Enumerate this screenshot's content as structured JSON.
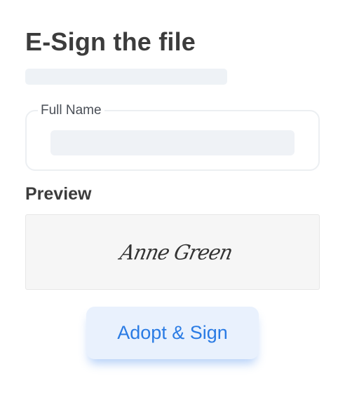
{
  "header": {
    "title": "E-Sign the file"
  },
  "full_name_field": {
    "label": "Full Name",
    "value": "",
    "placeholder": ""
  },
  "preview": {
    "heading": "Preview",
    "signature_text": "Anne Green"
  },
  "actions": {
    "adopt_sign_label": "Adopt & Sign"
  },
  "colors": {
    "accent": "#2a7be4",
    "button_bg": "#e9f1fd",
    "input_bg": "#eff2f6",
    "preview_bg": "#f6f6f6"
  }
}
